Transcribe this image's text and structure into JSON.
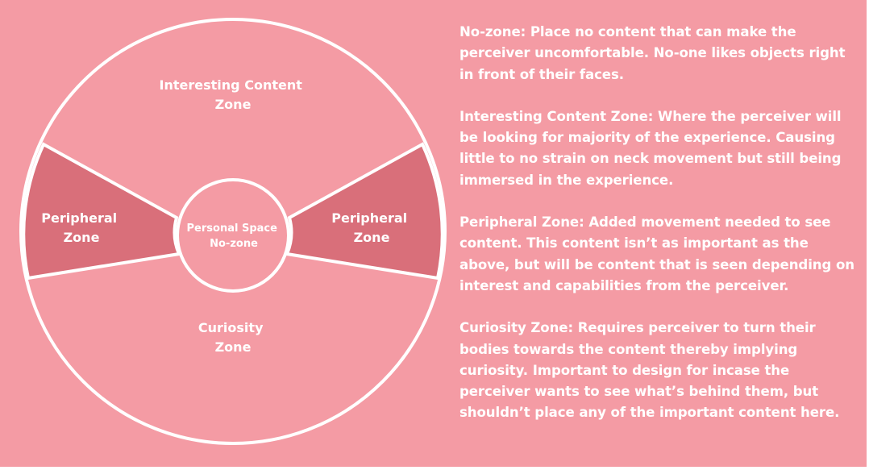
{
  "colors": {
    "background": "#f49ba4",
    "peripheral_fill": "#d96f7a",
    "lines": "#ffffff",
    "text": "#ffffff"
  },
  "zones": {
    "interesting": {
      "line1": "Interesting Content",
      "line2": "Zone"
    },
    "peripheral_left": {
      "line1": "Peripheral",
      "line2": "Zone"
    },
    "peripheral_right": {
      "line1": "Peripheral",
      "line2": "Zone"
    },
    "personal": {
      "line1": "Personal Space",
      "line2": "No-zone"
    },
    "curiosity": {
      "line1": "Curiosity",
      "line2": "Zone"
    }
  },
  "descriptions": [
    {
      "title": "No-zone:",
      "text": "Place no content that can make the perceiver uncomfortable. No-one likes objects right in front of their faces."
    },
    {
      "title": "Interesting Content Zone:",
      "text": "Where the perceiver will be looking for majority of the experience. Causing little to no strain on neck movement but still being immersed in the experience."
    },
    {
      "title": "Peripheral Zone:",
      "text": "Added movement needed to see content. This content isn’t as important as the above, but will be content that is seen depending on interest and capabilities from the perceiver."
    },
    {
      "title": "Curiosity Zone:",
      "text": "Requires perceiver to turn their bodies towards the content thereby implying curiosity. Important to design for incase the perceiver wants to see what’s behind them, but shouldn’t place any of the important content here."
    }
  ]
}
